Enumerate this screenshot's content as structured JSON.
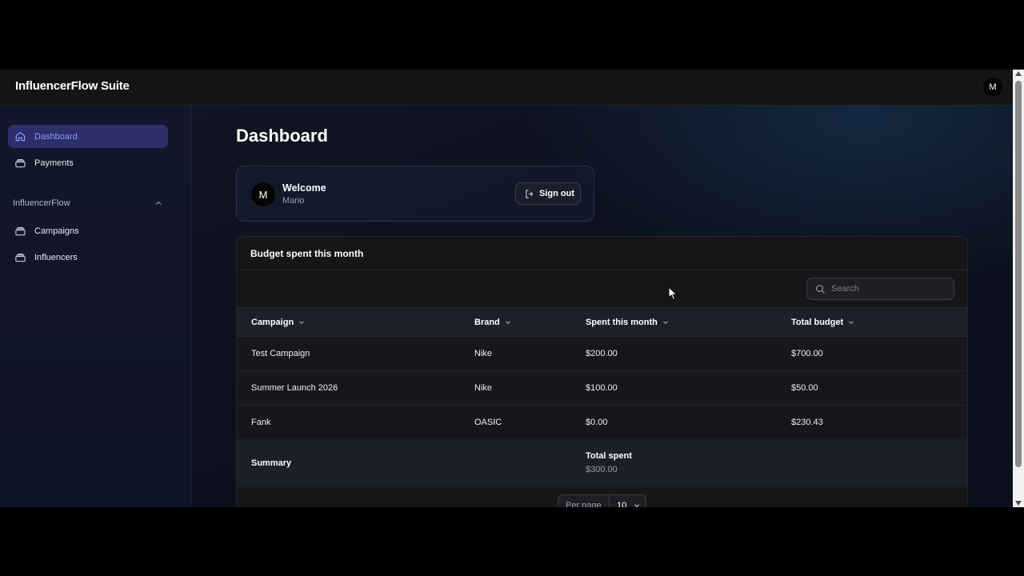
{
  "app": {
    "brand": "InfluencerFlow Suite",
    "user_initial": "M"
  },
  "sidebar": {
    "items": [
      {
        "label": "Dashboard",
        "icon": "home-icon",
        "active": true
      },
      {
        "label": "Payments",
        "icon": "stack-icon",
        "active": false
      }
    ],
    "group": {
      "label": "InfluencerFlow",
      "expanded": true,
      "items": [
        {
          "label": "Campaigns",
          "icon": "stack-icon"
        },
        {
          "label": "Influencers",
          "icon": "stack-icon"
        }
      ]
    }
  },
  "main": {
    "title": "Dashboard",
    "welcome": {
      "avatar": "M",
      "title": "Welcome",
      "name": "Mario",
      "signout_label": "Sign out"
    },
    "budget": {
      "title": "Budget spent this month",
      "search_placeholder": "Search",
      "columns": [
        "Campaign",
        "Brand",
        "Spent this month",
        "Total budget"
      ],
      "rows": [
        {
          "campaign": "Test Campaign",
          "brand": "Nike",
          "spent": "$200.00",
          "total": "$700.00"
        },
        {
          "campaign": "Summer Launch 2026",
          "brand": "Nike",
          "spent": "$100.00",
          "total": "$50.00"
        },
        {
          "campaign": "Fank",
          "brand": "OASIC",
          "spent": "$0.00",
          "total": "$230.43"
        }
      ],
      "summary": {
        "label": "Summary",
        "total_title": "Total spent",
        "total_value": "$300.00"
      },
      "pagination": {
        "per_page_label": "Per page",
        "per_page_value": "10"
      }
    }
  },
  "colors": {
    "accent": "#8e96ff",
    "active_bg": "#2d2f6a"
  }
}
